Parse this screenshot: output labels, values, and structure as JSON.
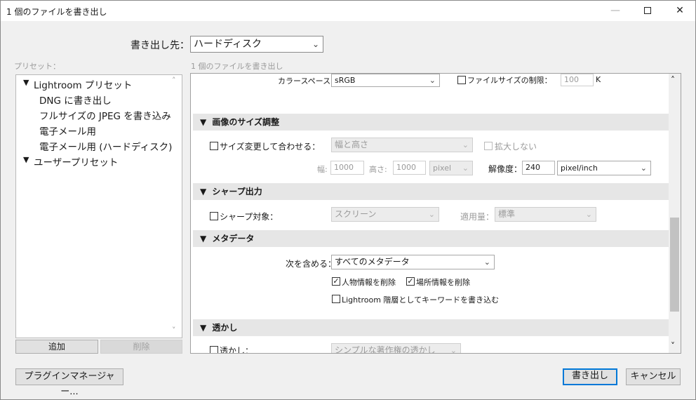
{
  "window": {
    "title": "1 個のファイルを書き出し",
    "min_glyph": "—",
    "max_glyph": "☐",
    "close_glyph": "✕"
  },
  "destination": {
    "label": "書き出し先：",
    "value": "ハードディスク"
  },
  "presets": {
    "label": "プリセット：",
    "groups": [
      {
        "label": "Lightroom プリセット",
        "items": [
          "DNG に書き出し",
          "フルサイズの JPEG を書き込み",
          "電子メール用",
          "電子メール用 (ハードディスク)"
        ]
      },
      {
        "label": "ユーザープリセット"
      }
    ],
    "add_label": "追加",
    "delete_label": "削除"
  },
  "summary_label": "1 個のファイルを書き出し",
  "color_space": {
    "label": "カラースペース：",
    "value": "sRGB"
  },
  "file_size_limit": {
    "label": "ファイルサイズの制限：",
    "value": "100",
    "unit": "K",
    "checked": false
  },
  "image_sizing": {
    "header": "画像のサイズ調整",
    "resize_label": "サイズ変更して合わせる：",
    "resize_checked": false,
    "resize_mode": "幅と高さ",
    "dont_enlarge_label": "拡大しない",
    "width_label": "幅:",
    "width_value": "1000",
    "height_label": "高さ:",
    "height_value": "1000",
    "unit": "pixel",
    "resolution_label": "解像度：",
    "resolution_value": "240",
    "resolution_unit": "pixel/inch"
  },
  "sharpening": {
    "header": "シャープ出力",
    "for_label": "シャープ対象：",
    "checked": false,
    "for_value": "スクリーン",
    "amount_label": "適用量：",
    "amount_value": "標準"
  },
  "metadata": {
    "header": "メタデータ",
    "include_label": "次を含める：",
    "include_value": "すべてのメタデータ",
    "remove_person_label": "人物情報を削除",
    "remove_person_checked": true,
    "remove_location_label": "場所情報を削除",
    "remove_location_checked": true,
    "keywords_label": "Lightroom 階層としてキーワードを書き込む",
    "keywords_checked": false
  },
  "watermark": {
    "header": "透かし",
    "label": "透かし：",
    "checked": false,
    "value": "シンプルな著作権の透かし"
  },
  "footer": {
    "plugin_manager_label": "プラグインマネージャー...",
    "export_label": "書き出し",
    "cancel_label": "キャンセル"
  },
  "glyphs": {
    "triangle": "▼",
    "chevron": "⌄",
    "check": "✓",
    "up": "˄",
    "down": "˅"
  }
}
